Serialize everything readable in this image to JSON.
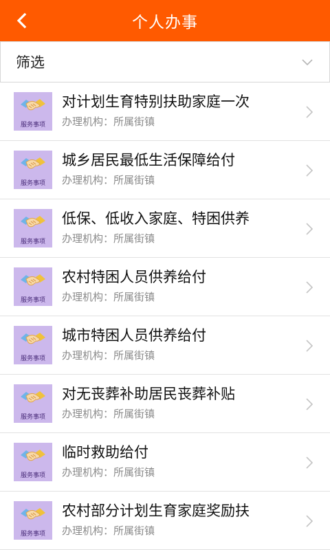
{
  "header": {
    "title": "个人办事"
  },
  "filter": {
    "label": "筛选"
  },
  "list": {
    "items": [
      {
        "title": "对计划生育特别扶助家庭一次",
        "subtitle": "办理机构：所属街镇",
        "icon_label": "服务事项"
      },
      {
        "title": "城乡居民最低生活保障给付",
        "subtitle": "办理机构：所属街镇",
        "icon_label": "服务事项"
      },
      {
        "title": "低保、低收入家庭、特困供养",
        "subtitle": "办理机构：所属街镇",
        "icon_label": "服务事项"
      },
      {
        "title": "农村特困人员供养给付",
        "subtitle": "办理机构：所属街镇",
        "icon_label": "服务事项"
      },
      {
        "title": "城市特困人员供养给付",
        "subtitle": "办理机构：所属街镇",
        "icon_label": "服务事项"
      },
      {
        "title": "对无丧葬补助居民丧葬补贴",
        "subtitle": "办理机构：所属街镇",
        "icon_label": "服务事项"
      },
      {
        "title": "临时救助给付",
        "subtitle": "办理机构：所属街镇",
        "icon_label": "服务事项"
      },
      {
        "title": "农村部分计划生育家庭奖励扶",
        "subtitle": "办理机构：所属街镇",
        "icon_label": "服务事项"
      }
    ]
  },
  "colors": {
    "header_bg": "#ff5a00",
    "icon_bg": "#ccb8ec"
  },
  "icons": {
    "back": "back-arrow-icon",
    "filter_dropdown": "chevron-down-icon",
    "row_arrow": "chevron-right-icon",
    "service": "handshake-icon"
  }
}
